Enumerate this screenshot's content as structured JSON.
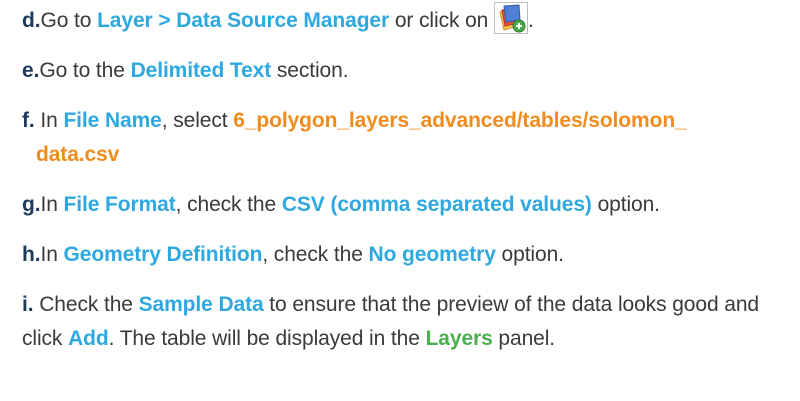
{
  "steps": [
    {
      "letter": "d.",
      "parts": [
        {
          "text": "Go to ",
          "style": "plain"
        },
        {
          "text": "Layer > Data Source Manager",
          "style": "blue"
        },
        {
          "text": " or click on ",
          "style": "plain"
        }
      ],
      "icon": "data-source-manager-icon",
      "after_icon": "."
    },
    {
      "letter": "e.",
      "parts": [
        {
          "text": "Go to the ",
          "style": "plain"
        },
        {
          "text": "Delimited Text",
          "style": "blue"
        },
        {
          "text": " section.",
          "style": "plain"
        }
      ]
    },
    {
      "letter": "f.",
      "parts": [
        {
          "text": " In ",
          "style": "plain"
        },
        {
          "text": "File Name",
          "style": "blue"
        },
        {
          "text": ", select ",
          "style": "plain"
        },
        {
          "text": "6_polygon_layers_advanced/tables/solomon_",
          "style": "orange"
        }
      ],
      "continuation": [
        {
          "text": "data.csv",
          "style": "orange"
        }
      ]
    },
    {
      "letter": "g.",
      "parts": [
        {
          "text": "In ",
          "style": "plain"
        },
        {
          "text": "File Format",
          "style": "blue"
        },
        {
          "text": ", check the ",
          "style": "plain"
        },
        {
          "text": "CSV (comma separated values)",
          "style": "blue"
        },
        {
          "text": " option.",
          "style": "plain"
        }
      ]
    },
    {
      "letter": "h.",
      "parts": [
        {
          "text": "In ",
          "style": "plain"
        },
        {
          "text": "Geometry Definition",
          "style": "blue"
        },
        {
          "text": ", check the ",
          "style": "plain"
        },
        {
          "text": "No geometry",
          "style": "blue"
        },
        {
          "text": " option.",
          "style": "plain"
        }
      ]
    },
    {
      "letter": "i.",
      "parts": [
        {
          "text": " Check the ",
          "style": "plain"
        },
        {
          "text": "Sample Data",
          "style": "blue"
        },
        {
          "text": " to ensure that the preview of the data looks good and click ",
          "style": "plain"
        },
        {
          "text": "Add",
          "style": "blue"
        },
        {
          "text": ". The table will be displayed in the ",
          "style": "plain"
        },
        {
          "text": "Layers",
          "style": "green"
        },
        {
          "text": " panel.",
          "style": "plain"
        }
      ]
    }
  ],
  "colors": {
    "letter": "#1f3b5c",
    "blue": "#2ea8e0",
    "orange": "#f08c1e",
    "green": "#4caf50",
    "body_text": "#3a3a3a"
  }
}
